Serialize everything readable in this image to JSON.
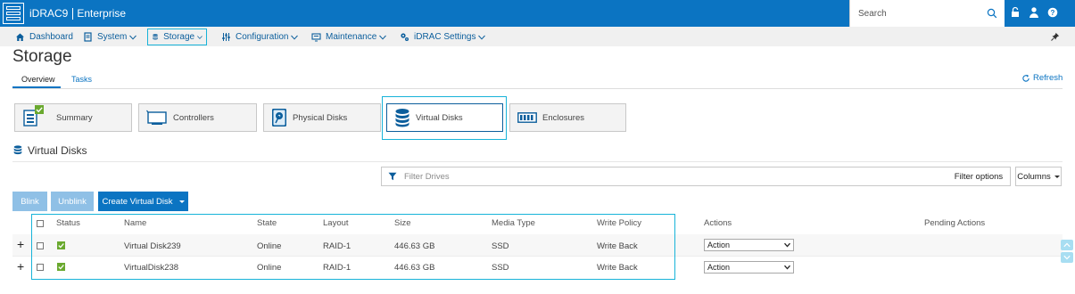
{
  "app": {
    "title": "iDRAC9",
    "edition": "Enterprise"
  },
  "search": {
    "placeholder": "Search"
  },
  "nav": [
    {
      "label": "Dashboard",
      "icon": "home-icon"
    },
    {
      "label": "System",
      "icon": "server-icon"
    },
    {
      "label": "Storage",
      "icon": "database-icon",
      "active": true
    },
    {
      "label": "Configuration",
      "icon": "sliders-icon"
    },
    {
      "label": "Maintenance",
      "icon": "monitor-icon"
    },
    {
      "label": "iDRAC Settings",
      "icon": "gears-icon"
    }
  ],
  "page": {
    "title": "Storage"
  },
  "tabs": {
    "overview": "Overview",
    "tasks": "Tasks",
    "active": "Overview"
  },
  "refresh_label": "Refresh",
  "cards": [
    {
      "label": "Summary",
      "icon": "summary-icon",
      "badge": "check-icon"
    },
    {
      "label": "Controllers",
      "icon": "controller-icon"
    },
    {
      "label": "Physical Disks",
      "icon": "physical-disk-icon"
    },
    {
      "label": "Virtual Disks",
      "icon": "virtual-disk-icon",
      "selected": true
    },
    {
      "label": "Enclosures",
      "icon": "enclosure-icon"
    }
  ],
  "section": {
    "title": "Virtual Disks"
  },
  "filter": {
    "placeholder": "Filter Drives",
    "options_label": "Filter options",
    "columns_label": "Columns"
  },
  "buttons": {
    "blink": "Blink",
    "unblink": "Unblink",
    "create": "Create Virtual Disk"
  },
  "table": {
    "headers": [
      "Status",
      "Name",
      "State",
      "Layout",
      "Size",
      "Media Type",
      "Write Policy",
      "Actions",
      "Pending Actions"
    ],
    "rows": [
      {
        "status": "ok",
        "name": "Virtual Disk239",
        "state": "Online",
        "layout": "RAID-1",
        "size": "446.63 GB",
        "media": "SSD",
        "write_policy": "Write Back",
        "action": "Action"
      },
      {
        "status": "ok",
        "name": "VirtualDisk238",
        "state": "Online",
        "layout": "RAID-1",
        "size": "446.63 GB",
        "media": "SSD",
        "write_policy": "Write Back",
        "action": "Action"
      }
    ]
  },
  "colors": {
    "brand_blue": "#0b74c2",
    "highlight": "#17b3d9",
    "status_ok": "#6aa92f"
  }
}
